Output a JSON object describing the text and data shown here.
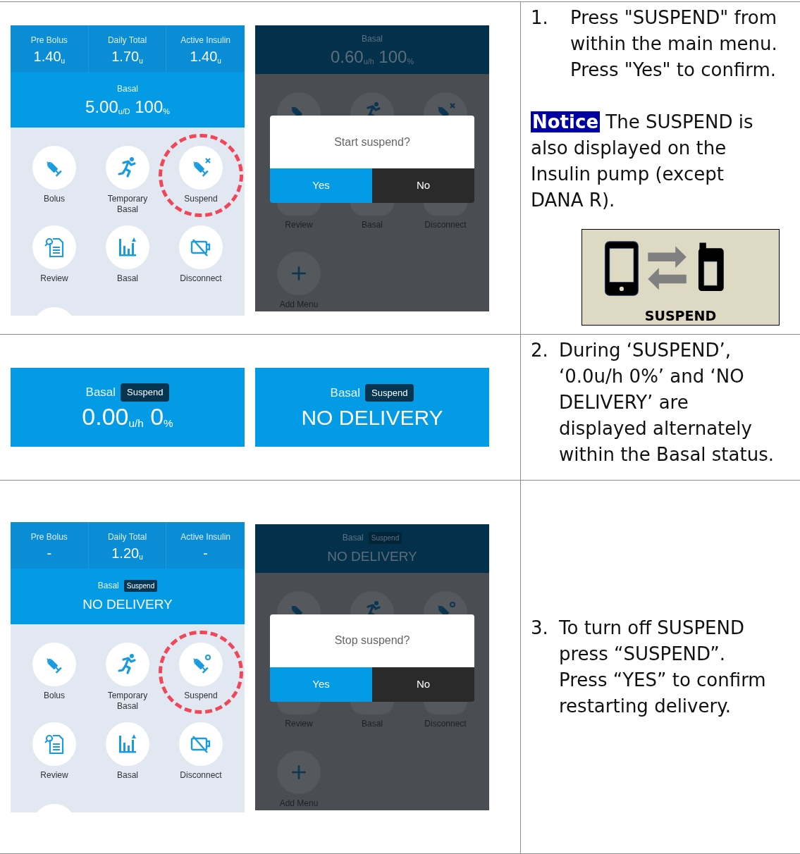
{
  "rows": [
    {
      "screens": [
        {
          "kind": "home",
          "suspended": false,
          "stats": [
            {
              "label": "Pre Bolus",
              "value": "1.40$_{u}$"
            },
            {
              "label": "Daily Total",
              "value": "1.70$_{u}$"
            },
            {
              "label": "Active Insulin",
              "value": "1.40$_{u}$"
            }
          ],
          "basal": {
            "label": "Basal",
            "value": "5.00$_{u/D}$ 100$_{%}$"
          },
          "tiles": [
            {
              "kind": "menu",
              "label": "Bolus",
              "highlighted": false
            },
            {
              "kind": "menu",
              "label": "Temporary Basal",
              "highlighted": false
            },
            {
              "kind": "menu",
              "label": "Suspend",
              "highlighted": true
            },
            {
              "kind": "menu",
              "label": "Review",
              "highlighted": false
            },
            {
              "kind": "menu",
              "label": "Basal",
              "highlighted": false
            },
            {
              "kind": "menu",
              "label": "Disconnect",
              "highlighted": false
            },
            {
              "kind": "partial"
            }
          ]
        },
        {
          "kind": "dialog",
          "suspended": false,
          "basal": {
            "label": "Basal",
            "value": "0.60$_{u/h}$ 100$_{%}$"
          },
          "tiles": [
            {
              "kind": "covered"
            },
            {
              "kind": "covered"
            },
            {
              "kind": "covered"
            },
            {
              "kind": "menu",
              "label": "Review"
            },
            {
              "kind": "menu",
              "label": "Basal"
            },
            {
              "kind": "menu",
              "label": "Disconnect"
            },
            {
              "kind": "add",
              "label": "Add Menu"
            }
          ],
          "dialog": {
            "message": "Start suspend?",
            "buttons": [
              {
                "kind": "confirm",
                "label": "Yes"
              },
              {
                "kind": "cancel",
                "label": "No"
              }
            ]
          }
        }
      ],
      "step": {
        "number": "1.",
        "sentences": [
          "Press \"SUSPEND\" from within the main menu.",
          "Press \"Yes\" to confirm."
        ],
        "notice": {
          "label": "Notice",
          "text": "The SUSPEND is also displayed on the Insulin pump (except DANA R)."
        },
        "figure": {
          "caption": "SUSPEND"
        }
      }
    },
    {
      "screens": [
        {
          "kind": "banner",
          "basal": {
            "label": "Basal",
            "badge": "Suspend",
            "value": "0.00$_{u/h}$ 0$_{%}$"
          }
        },
        {
          "kind": "banner",
          "basal": {
            "label": "Basal",
            "badge": "Suspend",
            "message": "NO DELIVERY"
          }
        }
      ],
      "step": {
        "number": "2.",
        "sentences": [
          "During ‘SUSPEND’, ‘0.0u/h 0%’ and ‘NO DELIVERY’ are displayed alternately within the Basal status."
        ]
      }
    },
    {
      "screens": [
        {
          "kind": "home",
          "suspended": true,
          "stats": [
            {
              "label": "Pre Bolus",
              "value": "-"
            },
            {
              "label": "Daily Total",
              "value": "1.20$_{u}$"
            },
            {
              "label": "Active Insulin",
              "value": "-"
            }
          ],
          "basal": {
            "label": "Basal",
            "badge": "Suspend",
            "message": "NO DELIVERY"
          },
          "tiles": [
            {
              "kind": "menu",
              "label": "Bolus",
              "highlighted": false
            },
            {
              "kind": "menu",
              "label": "Temporary Basal",
              "highlighted": false
            },
            {
              "kind": "menu",
              "label": "Suspend",
              "highlighted": true
            },
            {
              "kind": "menu",
              "label": "Review",
              "highlighted": false
            },
            {
              "kind": "menu",
              "label": "Basal",
              "highlighted": false
            },
            {
              "kind": "menu",
              "label": "Disconnect",
              "highlighted": false
            },
            {
              "kind": "partial"
            }
          ]
        },
        {
          "kind": "dialog",
          "suspended": true,
          "basal": {
            "label": "Basal",
            "badge": "Suspend",
            "message": "NO DELIVERY"
          },
          "tiles": [
            {
              "kind": "covered"
            },
            {
              "kind": "covered"
            },
            {
              "kind": "covered"
            },
            {
              "kind": "menu",
              "label": "Review"
            },
            {
              "kind": "menu",
              "label": "Basal"
            },
            {
              "kind": "menu",
              "label": "Disconnect"
            },
            {
              "kind": "add",
              "label": "Add Menu"
            }
          ],
          "dialog": {
            "message": "Stop suspend?",
            "buttons": [
              {
                "kind": "confirm",
                "label": "Yes"
              },
              {
                "kind": "cancel",
                "label": "No"
              }
            ]
          }
        }
      ],
      "step": {
        "number": "3.",
        "sentences": [
          "To turn off SUSPEND press “SUSPEND”.",
          "Press “YES” to confirm restarting delivery."
        ]
      }
    }
  ]
}
